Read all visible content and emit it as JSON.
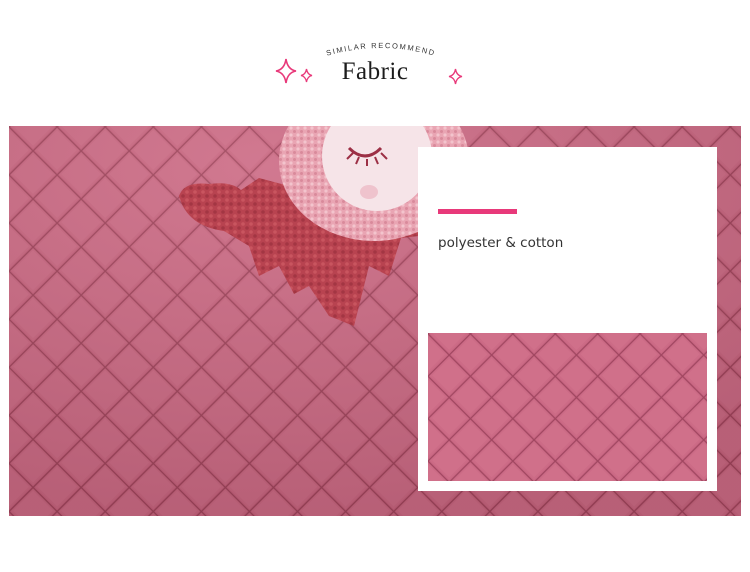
{
  "header": {
    "subtitle": "SIMILAR   RECOMMEND",
    "title": "Fabric",
    "sparkle_icon": "four-point-star-icon"
  },
  "card": {
    "material": "polyester & cotton"
  },
  "colors": {
    "accent": "#e8397a",
    "fabric_pink": "#c25d78",
    "emblem_red": "#b8404f",
    "emblem_light": "#e9a5b3"
  }
}
